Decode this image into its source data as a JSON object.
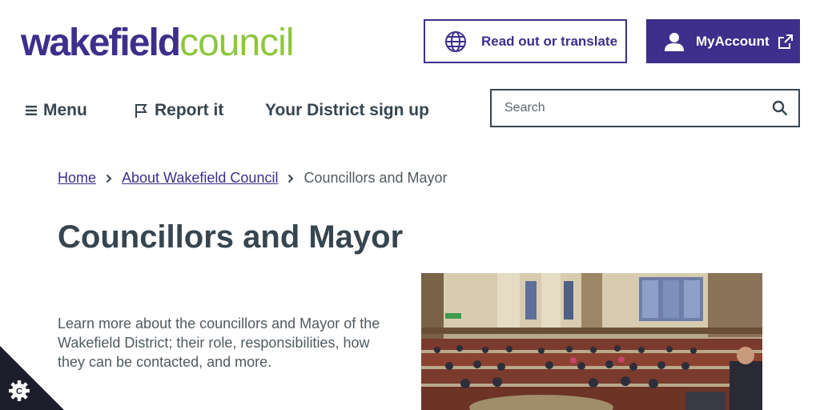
{
  "logo": {
    "part1": "wakefield",
    "part2": "council"
  },
  "header": {
    "translate_label": "Read out or translate",
    "account_label": "MyAccount"
  },
  "nav": {
    "menu_label": "Menu",
    "report_label": "Report it",
    "district_label": "Your District sign up"
  },
  "search": {
    "placeholder": "Search"
  },
  "breadcrumb": {
    "home": "Home",
    "about": "About Wakefield Council",
    "current": "Councillors and Mayor"
  },
  "page": {
    "title": "Councillors and Mayor",
    "intro": "Learn more about the councillors and Mayor of the Wakefield District; their role, responsibilities, how they can be contacted, and more."
  },
  "icons": {
    "translate": "globe-icon",
    "account": "user-icon",
    "external": "external-link-icon",
    "menu": "hamburger-icon",
    "report": "flag-icon",
    "search": "search-icon",
    "cookie": "cookie-icon"
  },
  "colors": {
    "brand_purple": "#3d2f8b",
    "brand_green": "#8dc63f",
    "text": "#36454f"
  }
}
